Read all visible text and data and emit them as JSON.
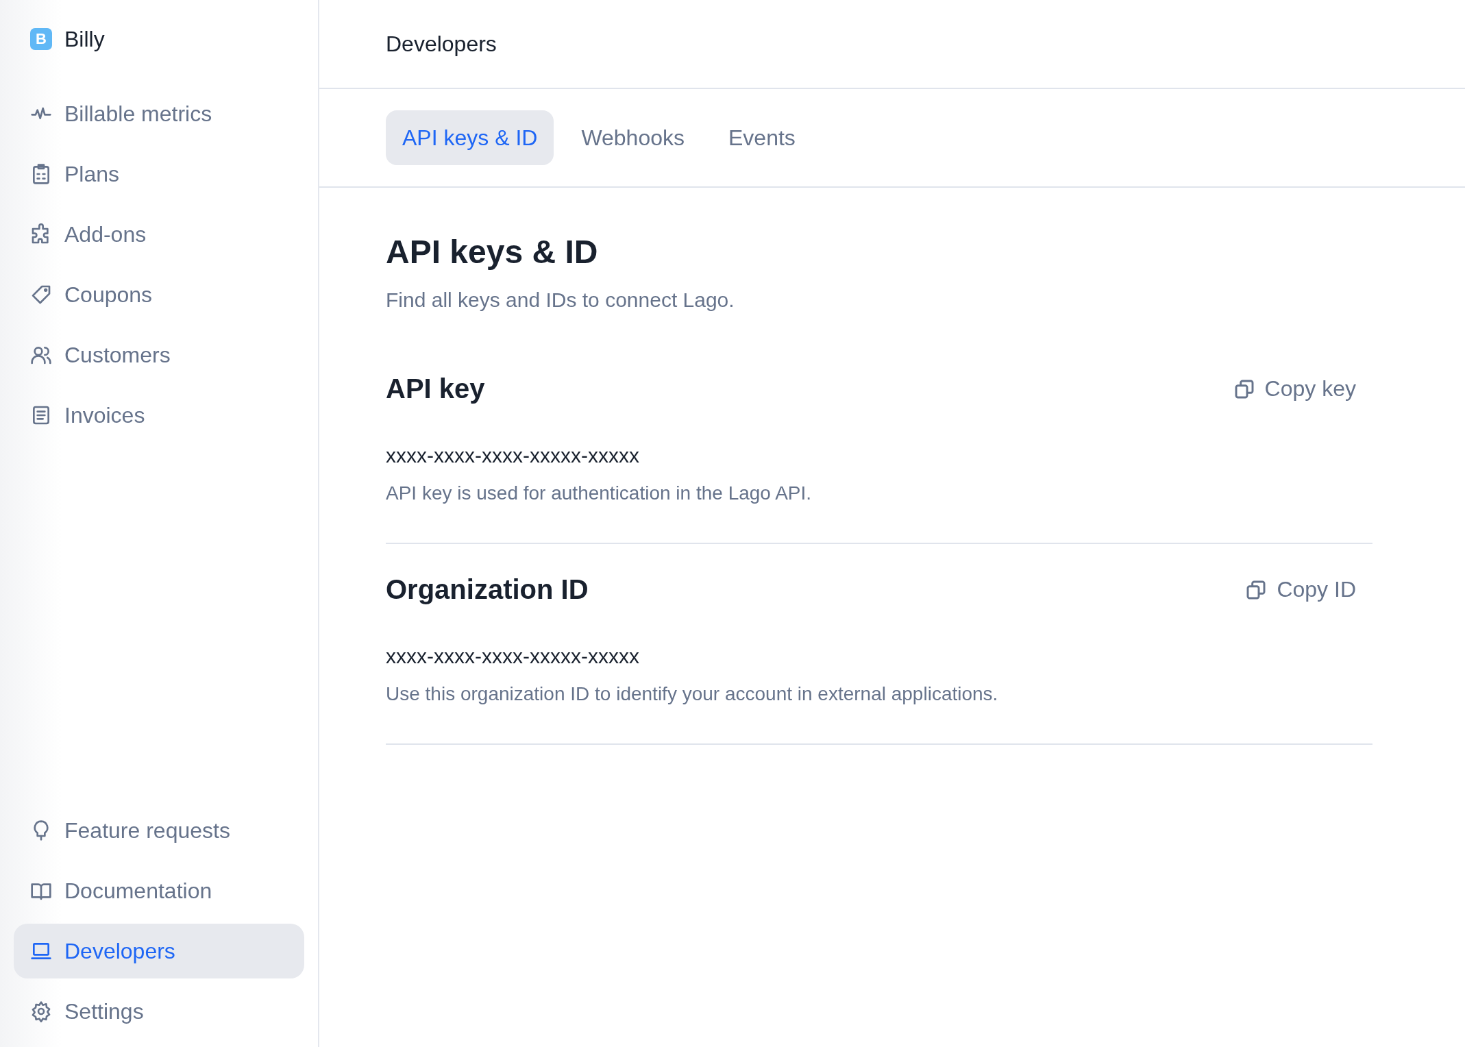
{
  "sidebar": {
    "org": {
      "initial": "B",
      "name": "Billy"
    },
    "top_items": [
      {
        "label": "Billable metrics",
        "selected": false
      },
      {
        "label": "Plans",
        "selected": false
      },
      {
        "label": "Add-ons",
        "selected": false
      },
      {
        "label": "Coupons",
        "selected": false
      },
      {
        "label": "Customers",
        "selected": false
      },
      {
        "label": "Invoices",
        "selected": false
      }
    ],
    "bottom_items": [
      {
        "label": "Feature requests",
        "selected": false
      },
      {
        "label": "Documentation",
        "selected": false
      },
      {
        "label": "Developers",
        "selected": true
      },
      {
        "label": "Settings",
        "selected": false
      }
    ]
  },
  "header": {
    "title": "Developers"
  },
  "tabs": [
    {
      "label": "API keys & ID",
      "selected": true
    },
    {
      "label": "Webhooks",
      "selected": false
    },
    {
      "label": "Events",
      "selected": false
    }
  ],
  "page": {
    "title": "API keys & ID",
    "subtitle": "Find all keys and IDs to connect Lago."
  },
  "sections": [
    {
      "title": "API key",
      "action": "Copy key",
      "value": "xxxx-xxxx-xxxx-xxxxx-xxxxx",
      "description": "API key is used for authentication in the Lago API."
    },
    {
      "title": "Organization ID",
      "action": "Copy ID",
      "value": "xxxx-xxxx-xxxx-xxxxx-xxxxx",
      "description": "Use this organization ID to identify your account in external applications."
    }
  ]
}
